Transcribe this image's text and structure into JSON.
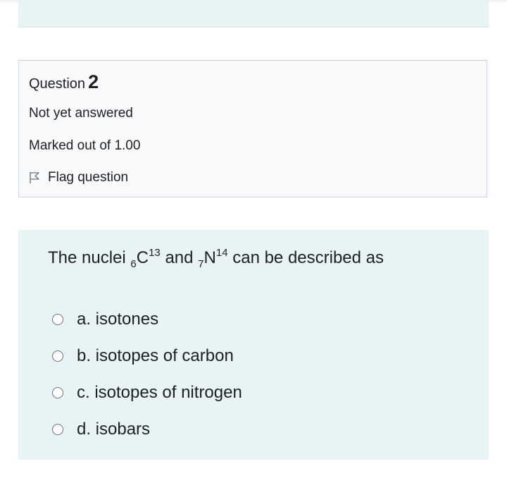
{
  "question_info": {
    "title_word": "Question",
    "number": "2",
    "state": "Not yet answered",
    "grade": "Marked out of 1.00",
    "flag_label": "Flag question"
  },
  "question": {
    "text_before": "The nuclei ",
    "nucleus1_sub": "6",
    "nucleus1_symbol": "C",
    "nucleus1_sup": "13",
    "text_middle": " and ",
    "nucleus2_sub": "7",
    "nucleus2_symbol": "N",
    "nucleus2_sup": "14",
    "text_after": " can be described as"
  },
  "answers": [
    {
      "label": "a. isotones",
      "selected": false
    },
    {
      "label": "b. isotopes of carbon",
      "selected": false
    },
    {
      "label": "c. isotopes of nitrogen",
      "selected": false
    },
    {
      "label": "d. isobars",
      "selected": false
    }
  ],
  "colors": {
    "content_bg": "#e7f3f5",
    "info_bg": "#f8f9fa",
    "info_border": "#cfd4da",
    "text": "#1d2125"
  },
  "icons": {
    "flag": "flag-icon",
    "radio": "radio-button"
  }
}
